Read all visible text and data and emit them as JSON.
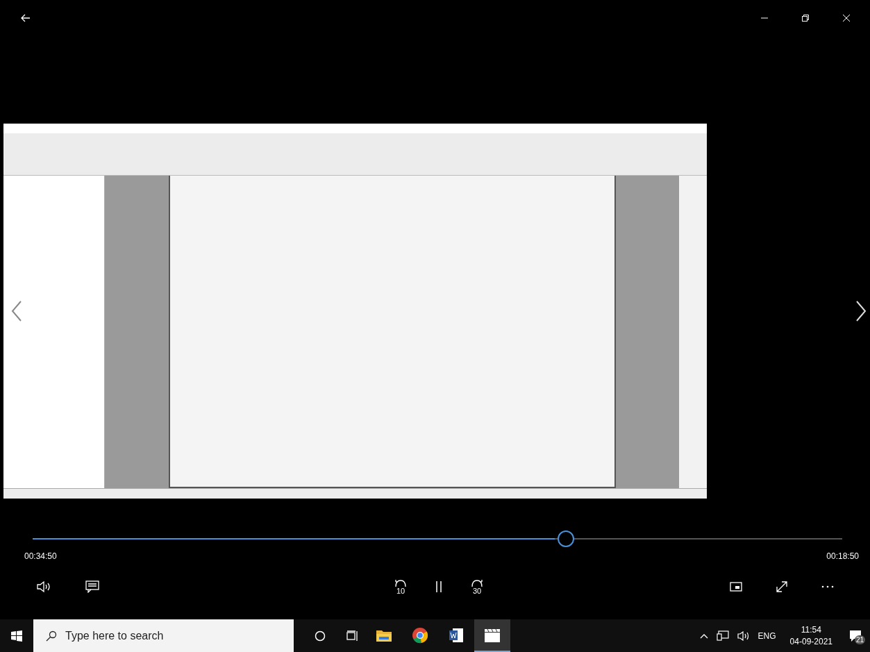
{
  "playback": {
    "position": "00:34:50",
    "remaining": "00:18:50",
    "level": 0.645
  },
  "controls": {
    "skip_back": "10",
    "skip_forward": "30"
  },
  "taskbar": {
    "search_placeholder": "Type here to search",
    "language": "ENG",
    "time": "11:54",
    "date": "04-09-2021",
    "notification_count": "21",
    "apps": [
      {
        "kind": "folder",
        "active": false
      },
      {
        "kind": "chrome",
        "active": false
      },
      {
        "kind": "word",
        "active": false
      },
      {
        "kind": "video",
        "active": true
      }
    ]
  }
}
